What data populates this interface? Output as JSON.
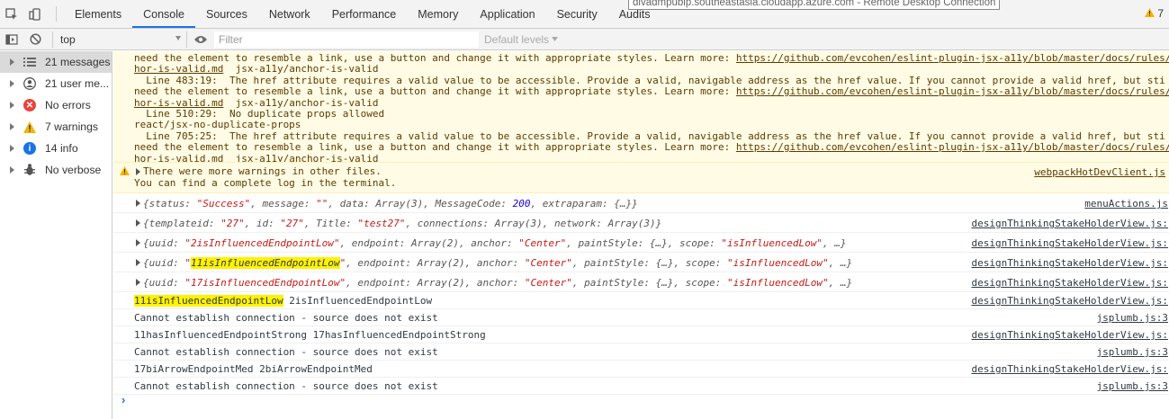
{
  "tooltip": "divadmpubip.southeastasia.cloudapp.azure.com - Remote Desktop Connection",
  "tabs": [
    "Elements",
    "Console",
    "Sources",
    "Network",
    "Performance",
    "Memory",
    "Application",
    "Security",
    "Audits"
  ],
  "active_tab": "Console",
  "warning_badge": "7",
  "filterbar": {
    "context": "top",
    "filter_placeholder": "Filter",
    "levels": "Default levels"
  },
  "sidebar": [
    {
      "label": "21 messages",
      "icon": "list-icon"
    },
    {
      "label": "21 user me...",
      "icon": "user-icon"
    },
    {
      "label": "No errors",
      "icon": "error-icon"
    },
    {
      "label": "7 warnings",
      "icon": "warning-icon"
    },
    {
      "label": "14 info",
      "icon": "info-icon"
    },
    {
      "label": "No verbose",
      "icon": "bug-icon"
    }
  ],
  "warning_lines": [
    "need the element to resemble a link, use a button and change it with appropriate styles. Learn more: https://github.com/evcohen/eslint-plugin-jsx-a11y/blob/master/docs/rules/",
    "hor-is-valid.md  jsx-a11y/anchor-is-valid",
    "  Line 483:19:  The href attribute requires a valid value to be accessible. Provide a valid, navigable address as the href value. If you cannot provide a valid href, but sti",
    "need the element to resemble a link, use a button and change it with appropriate styles. Learn more: https://github.com/evcohen/eslint-plugin-jsx-a11y/blob/master/docs/rules/",
    "hor-is-valid.md  jsx-a11y/anchor-is-valid",
    "  Line 510:29:  No duplicate props allowed",
    "react/jsx-no-duplicate-props",
    "  Line 705:25:  The href attribute requires a valid value to be accessible. Provide a valid, navigable address as the href value. If you cannot provide a valid href, but sti",
    "need the element to resemble a link, use a button and change it with appropriate styles. Learn more: https://github.com/evcohen/eslint-plugin-jsx-a11y/blob/master/docs/rules/",
    "hor-is-valid.md  jsx-a11y/anchor-is-valid"
  ],
  "more_warnings": {
    "line1": "There were more warnings in other files.",
    "line2": "You can find a complete log in the terminal.",
    "source": "webpackHotDevClient.js"
  },
  "log_rows": [
    {
      "kind": "obj",
      "parts": [
        [
          "k",
          "{status: "
        ],
        [
          "s",
          "\"Success\""
        ],
        [
          "k",
          ", message: "
        ],
        [
          "s",
          "\"\""
        ],
        [
          "k",
          ", data: "
        ],
        [
          "k",
          "Array(3)"
        ],
        [
          "k",
          ", MessageCode: "
        ],
        [
          "n",
          "200"
        ],
        [
          "k",
          ", extraparam: {…}}"
        ]
      ],
      "source": "menuActions.js"
    },
    {
      "kind": "obj",
      "parts": [
        [
          "k",
          "{templateid: "
        ],
        [
          "s",
          "\"27\""
        ],
        [
          "k",
          ", id: "
        ],
        [
          "s",
          "\"27\""
        ],
        [
          "k",
          ", Title: "
        ],
        [
          "s",
          "\"test27\""
        ],
        [
          "k",
          ", connections: Array(3), network: Array(3)}"
        ]
      ],
      "source": "designThinkingStakeHolderView.js:"
    },
    {
      "kind": "obj",
      "parts": [
        [
          "k",
          "{uuid: "
        ],
        [
          "s",
          "\"2isInfluencedEndpointLow\""
        ],
        [
          "k",
          ", endpoint: Array(2), anchor: "
        ],
        [
          "s",
          "\"Center\""
        ],
        [
          "k",
          ", paintStyle: {…}, scope: "
        ],
        [
          "s",
          "\"isInfluencedLow\""
        ],
        [
          "k",
          ", …}"
        ]
      ],
      "source": "designThinkingStakeHolderView.js:"
    },
    {
      "kind": "obj",
      "parts": [
        [
          "k",
          "{uuid: "
        ],
        [
          "s",
          "\""
        ],
        [
          "hl",
          "11isInfluencedEndpointLow"
        ],
        [
          "s",
          "\""
        ],
        [
          "k",
          ", endpoint: Array(2), anchor: "
        ],
        [
          "s",
          "\"Center\""
        ],
        [
          "k",
          ", paintStyle: {…}, scope: "
        ],
        [
          "s",
          "\"isInfluencedLow\""
        ],
        [
          "k",
          ", …}"
        ]
      ],
      "source": "designThinkingStakeHolderView.js:"
    },
    {
      "kind": "obj",
      "parts": [
        [
          "k",
          "{uuid: "
        ],
        [
          "s",
          "\"17isInfluencedEndpointLow\""
        ],
        [
          "k",
          ", endpoint: Array(2), anchor: "
        ],
        [
          "s",
          "\"Center\""
        ],
        [
          "k",
          ", paintStyle: {…}, scope: "
        ],
        [
          "s",
          "\"isInfluencedLow\""
        ],
        [
          "k",
          ", …}"
        ]
      ],
      "source": "designThinkingStakeHolderView.js:"
    },
    {
      "kind": "plain",
      "parts": [
        [
          "hl",
          "11isInfluencedEndpointLow"
        ],
        [
          "p",
          " 2isInfluencedEndpointLow"
        ]
      ],
      "source": "designThinkingStakeHolderView.js:"
    },
    {
      "kind": "plain",
      "parts": [
        [
          "p",
          "Cannot establish connection - source does not exist"
        ]
      ],
      "source": "jsplumb.js:3"
    },
    {
      "kind": "plain",
      "parts": [
        [
          "p",
          "11hasInfluencedEndpointStrong 17hasInfluencedEndpointStrong"
        ]
      ],
      "source": "designThinkingStakeHolderView.js:"
    },
    {
      "kind": "plain",
      "parts": [
        [
          "p",
          "Cannot establish connection - source does not exist"
        ]
      ],
      "source": "jsplumb.js:3"
    },
    {
      "kind": "plain",
      "parts": [
        [
          "p",
          "17biArrowEndpointMed 2biArrowEndpointMed"
        ]
      ],
      "source": "designThinkingStakeHolderView.js:"
    },
    {
      "kind": "plain",
      "parts": [
        [
          "p",
          "Cannot establish connection - source does not exist"
        ]
      ],
      "source": "jsplumb.js:3"
    }
  ],
  "prompt_symbol": "›"
}
